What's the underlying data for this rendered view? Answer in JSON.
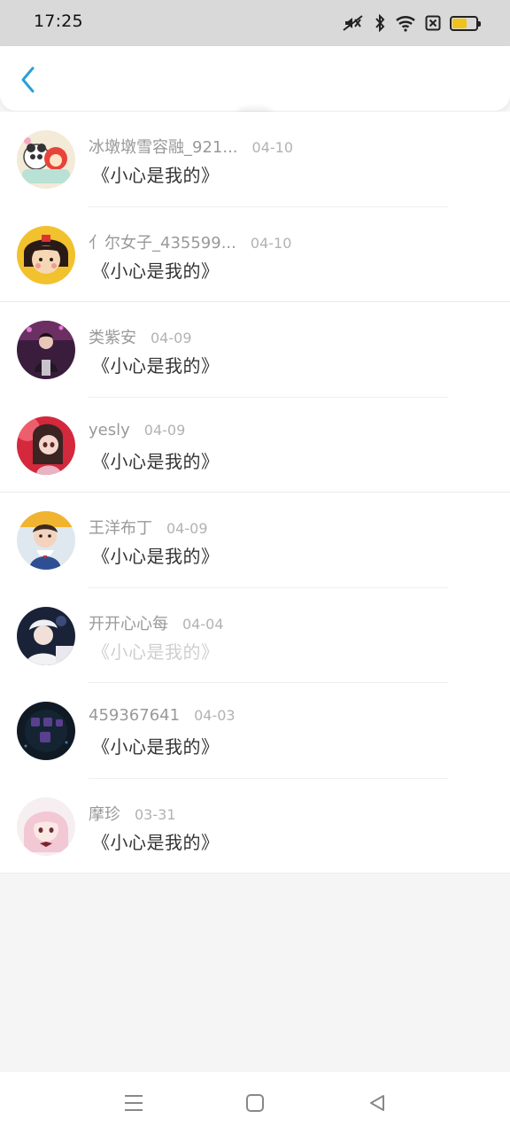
{
  "status_bar": {
    "time": "17:25",
    "icons": [
      "mute-icon",
      "bluetooth-icon",
      "wifi-icon",
      "sim-off-icon",
      "battery-icon"
    ],
    "battery_color": "#f1c21b"
  },
  "header": {
    "back_icon": "chevron-left-icon",
    "accent_color": "#2a9fd8"
  },
  "items": [
    {
      "name": "冰墩墩雪容融_921...",
      "date": "04-10",
      "message": "《小心是我的》",
      "faded": false
    },
    {
      "name": "亻尔女子_435599...",
      "date": "04-10",
      "message": "《小心是我的》",
      "faded": false
    },
    {
      "name": "类紫安",
      "date": "04-09",
      "message": "《小心是我的》",
      "faded": false
    },
    {
      "name": "yesly",
      "date": "04-09",
      "message": "《小心是我的》",
      "faded": false
    },
    {
      "name": "王洋布丁",
      "date": "04-09",
      "message": "《小心是我的》",
      "faded": false
    },
    {
      "name": "开开心心每",
      "date": "04-04",
      "message": "《小心是我的》",
      "faded": true
    },
    {
      "name": "459367641",
      "date": "04-03",
      "message": "《小心是我的》",
      "faded": false
    },
    {
      "name": "摩珍",
      "date": "03-31",
      "message": "《小心是我的》",
      "faded": false
    }
  ],
  "nav_bar": {
    "buttons": [
      "menu-icon",
      "home-icon",
      "back-triangle-icon"
    ]
  }
}
